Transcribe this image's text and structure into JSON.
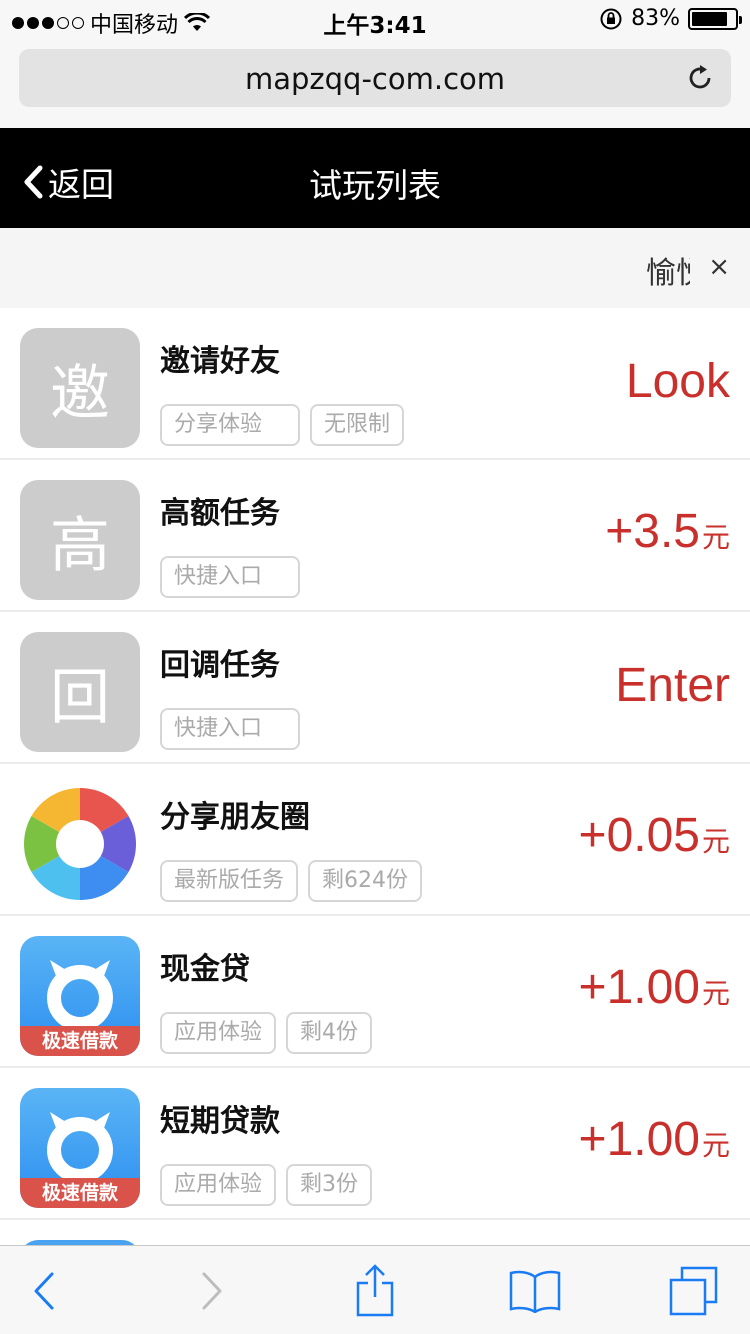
{
  "status_bar": {
    "carrier": "中国移动",
    "time": "上午3:41",
    "battery_percent": "83%",
    "battery_level": 0.83
  },
  "browser": {
    "url": "mapzqq-com.com"
  },
  "nav": {
    "back_label": "返回",
    "title": "试玩列表"
  },
  "notice": {
    "text": "愉悦",
    "close_label": "×"
  },
  "tasks": [
    {
      "icon_letter": "邀",
      "name": "邀请好友",
      "tags": [
        "分享体验",
        "无限制"
      ],
      "reward": "Look",
      "unit": ""
    },
    {
      "icon_letter": "高",
      "name": "高额任务",
      "tags": [
        "快捷入口"
      ],
      "reward": "+3.5",
      "unit": "元"
    },
    {
      "icon_letter": "回",
      "name": "回调任务",
      "tags": [
        "快捷入口"
      ],
      "reward": "Enter",
      "unit": ""
    },
    {
      "icon": "aperture-icon",
      "name": "分享朋友圈",
      "tags": [
        "最新版任务",
        "剩624份"
      ],
      "reward": "+0.05",
      "unit": "元"
    },
    {
      "icon": "loan-app-icon",
      "icon_banner": "极速借款",
      "name": "现金贷",
      "tags": [
        "应用体验",
        "剩4份"
      ],
      "reward": "+1.00",
      "unit": "元"
    },
    {
      "icon": "loan-app-icon",
      "icon_banner": "极速借款",
      "name": "短期贷款",
      "tags": [
        "应用体验",
        "剩3份"
      ],
      "reward": "+1.00",
      "unit": "元"
    }
  ],
  "toolbar": {
    "icons": [
      "back-arrow-icon",
      "forward-arrow-icon",
      "share-icon",
      "bookmarks-icon",
      "tabs-icon"
    ]
  },
  "colors": {
    "accent_red": "#c9302c",
    "nav_bg": "#000000",
    "ios_blue": "#1a7cf5"
  }
}
